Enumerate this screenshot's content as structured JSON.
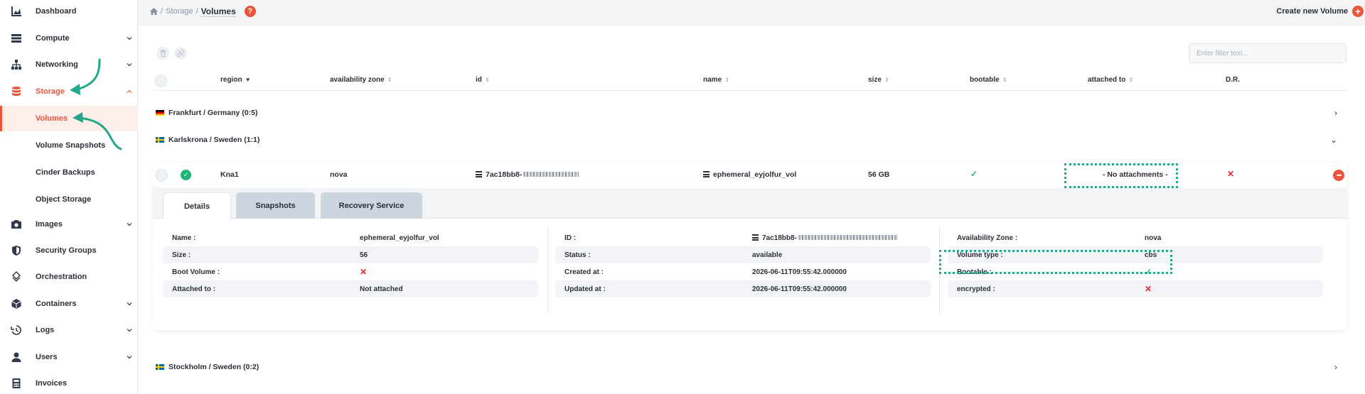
{
  "sidebar": {
    "items": [
      {
        "label": "Dashboard",
        "icon": "chart-area-icon"
      },
      {
        "label": "Compute",
        "icon": "server-icon"
      },
      {
        "label": "Networking",
        "icon": "sitemap-icon"
      },
      {
        "label": "Storage",
        "icon": "database-icon"
      },
      {
        "label": "Images",
        "icon": "camera-icon"
      },
      {
        "label": "Security Groups",
        "icon": "shield-icon"
      },
      {
        "label": "Orchestration",
        "icon": "layers-icon"
      },
      {
        "label": "Containers",
        "icon": "cube-icon"
      },
      {
        "label": "Logs",
        "icon": "history-icon"
      },
      {
        "label": "Users",
        "icon": "user-icon"
      },
      {
        "label": "Invoices",
        "icon": "calculator-icon"
      }
    ],
    "storage_sub": [
      {
        "label": "Volumes"
      },
      {
        "label": "Volume Snapshots"
      },
      {
        "label": "Cinder Backups"
      },
      {
        "label": "Object Storage"
      }
    ]
  },
  "breadcrumb": {
    "part1": "Storage",
    "part2": "Volumes",
    "help": "?"
  },
  "create": {
    "label": "Create new Volume",
    "plus": "+"
  },
  "filter": {
    "placeholder": "Enter filter text..."
  },
  "table": {
    "headers": [
      "region",
      "availability zone",
      "id",
      "name",
      "size",
      "bootable",
      "attached to",
      "D.R."
    ]
  },
  "groups": [
    {
      "label": "Frankfurt / Germany (0:5)"
    },
    {
      "label": "Karlskrona / Sweden (1:1)"
    },
    {
      "label": "Stockholm / Sweden (0:2)"
    }
  ],
  "row": {
    "region": "Kna1",
    "zone": "nova",
    "id": "7ac18bb8-",
    "name": "ephemeral_eyjolfur_vol",
    "size": "56 GB",
    "attached": "- No attachments -"
  },
  "detail": {
    "tabs": [
      "Details",
      "Snapshots",
      "Recovery Service"
    ],
    "col1": [
      {
        "label": "Name :",
        "value": "ephemeral_eyjolfur_vol"
      },
      {
        "label": "Size :",
        "value": "56"
      },
      {
        "label": "Boot Volume :",
        "value": ""
      },
      {
        "label": "Attached to :",
        "value": "Not attached"
      }
    ],
    "col2": [
      {
        "label": "ID :",
        "value": "7ac18bb8-"
      },
      {
        "label": "Status :",
        "value": "available"
      },
      {
        "label": "Created at :",
        "value": "2026-06-11T09:55:42.000000"
      },
      {
        "label": "Updated at :",
        "value": "2026-06-11T09:55:42.000000"
      }
    ],
    "col3": [
      {
        "label": "Availability Zone :",
        "value": "nova"
      },
      {
        "label": "Volume type :",
        "value": "cbs"
      },
      {
        "label": "Bootable :",
        "value": ""
      },
      {
        "label": "encrypted :",
        "value": ""
      }
    ]
  },
  "colors": {
    "accent": "#e8553a",
    "success": "#1fb375",
    "danger": "#e0262f",
    "annotation": "#22a98a"
  }
}
